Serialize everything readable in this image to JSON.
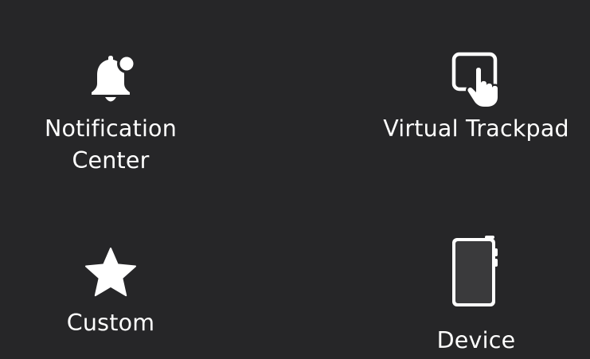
{
  "assistive_touch_menu": {
    "items": [
      {
        "label_line1": "Notification",
        "label_line2": "Center",
        "icon": "bell-icon"
      },
      {
        "label": "Virtual Trackpad",
        "icon": "trackpad-pointer-icon"
      },
      {
        "label": "Custom",
        "icon": "star-icon"
      },
      {
        "label": "Device",
        "icon": "device-icon"
      }
    ]
  },
  "colors": {
    "background": "#262628",
    "foreground": "#ffffff",
    "device_screen": "#3a3a3c"
  }
}
